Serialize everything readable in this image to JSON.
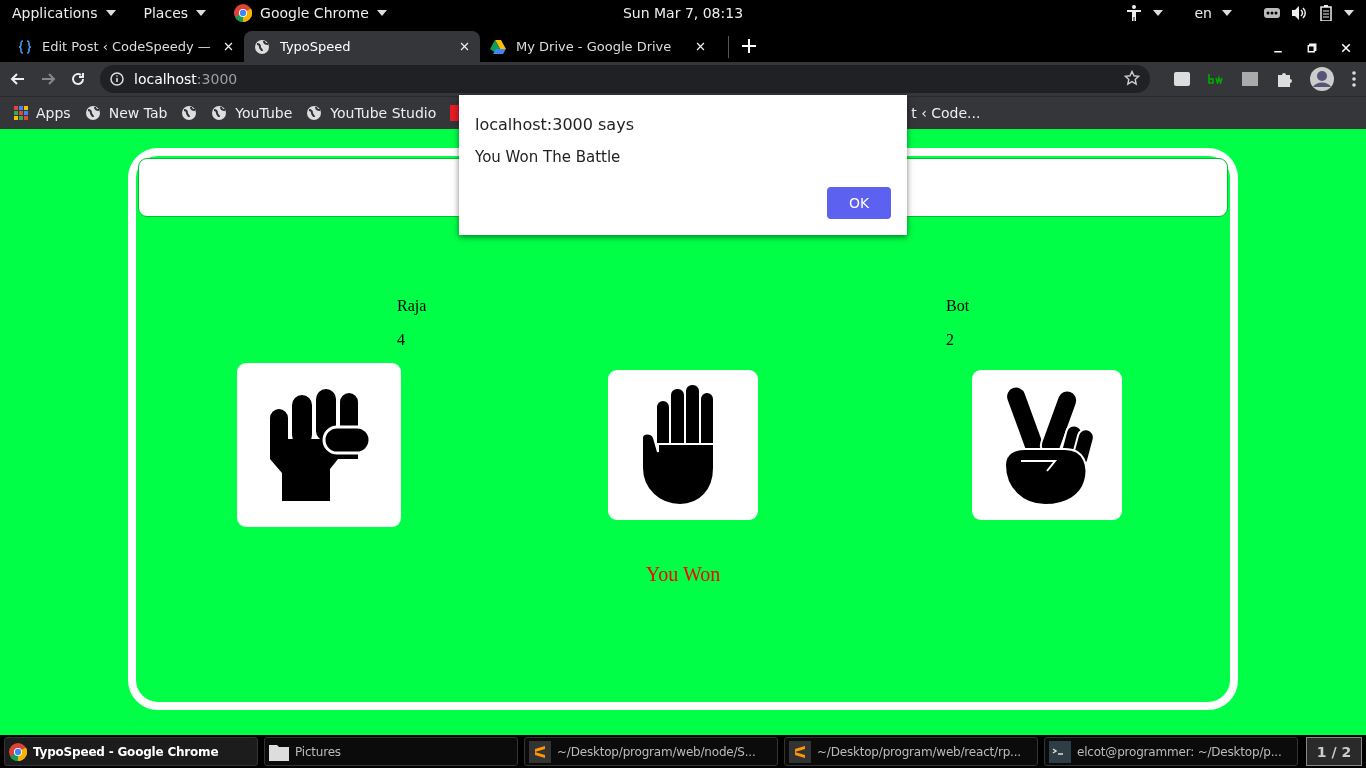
{
  "top_bar": {
    "menus": [
      {
        "label": "Applications",
        "kind": "plain"
      },
      {
        "label": "Places",
        "kind": "plain"
      },
      {
        "label": "Google Chrome",
        "kind": "chrome"
      }
    ],
    "clock": "Sun Mar  7, 08:13",
    "language": "en"
  },
  "tabs": [
    {
      "title": "Edit Post ‹ CodeSpeedy —",
      "kind": "braces",
      "selected": false
    },
    {
      "title": "TypoSpeed",
      "kind": "globe",
      "selected": true
    },
    {
      "title": "My Drive - Google Drive",
      "kind": "drive",
      "selected": false
    }
  ],
  "address": {
    "host": "localhost",
    "port": ":3000"
  },
  "bookmarks": [
    {
      "label": "Apps",
      "kind": "apps"
    },
    {
      "label": "New Tab",
      "kind": "globe"
    },
    {
      "kind": "globe"
    },
    {
      "label": "YouTube",
      "kind": "globe"
    },
    {
      "label": "YouTube Studio",
      "kind": "globe"
    },
    {
      "kind": "red"
    },
    {
      "label": "t ‹ Code...",
      "kind": "partial"
    }
  ],
  "page": {
    "players": [
      {
        "name": "Raja",
        "score": "4"
      },
      {
        "name": "Bot",
        "score": "2"
      }
    ],
    "moves": [
      {
        "kind": "rock"
      },
      {
        "kind": "paper"
      },
      {
        "kind": "scissors"
      }
    ],
    "result": "You Won"
  },
  "dialog": {
    "title": "localhost:3000 says",
    "message": "You Won The Battle",
    "button": "OK"
  },
  "taskbar": {
    "tasks": [
      {
        "label": "TypoSpeed - Google Chrome",
        "kind": "chrome",
        "selected": true
      },
      {
        "label": "Pictures",
        "kind": "folder",
        "selected": false
      },
      {
        "label": "~/Desktop/program/web/node/S...",
        "kind": "sublime",
        "selected": false
      },
      {
        "label": "~/Desktop/program/web/react/rp...",
        "kind": "sublime",
        "selected": false
      },
      {
        "label": "elcot@programmer: ~/Desktop/p...",
        "kind": "terminal",
        "selected": false
      }
    ],
    "workspace": "1 / 2"
  }
}
